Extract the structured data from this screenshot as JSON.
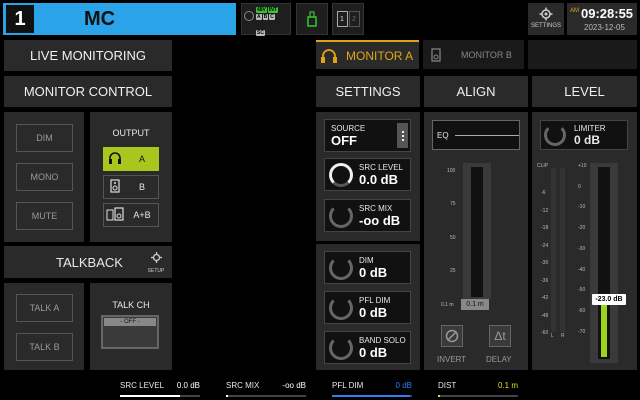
{
  "scene": {
    "number": "1",
    "name": "MC"
  },
  "io": {
    "upper_row": [
      "48V",
      "INT"
    ],
    "mid_row": [
      "A",
      "B",
      "C"
    ],
    "sc": "SC"
  },
  "settings_label": "SETTINGS",
  "clock": {
    "ampm": "AM",
    "time": "09:28:55",
    "date": "2023-12-05"
  },
  "left": {
    "live_monitoring": "LIVE MONITORING",
    "monitor_control": "MONITOR CONTROL",
    "dim": "DIM",
    "mono": "MONO",
    "mute": "MUTE",
    "output_title": "OUTPUT",
    "outputs": [
      {
        "label": "A",
        "icon": "headphones-icon",
        "selected": true
      },
      {
        "label": "B",
        "icon": "speaker-icon",
        "selected": false
      },
      {
        "label": "A+B",
        "icon": "speaker-pair-icon",
        "selected": false
      }
    ],
    "talkback": "TALKBACK",
    "talkback_setup": "SETUP",
    "talk_a": "TALK A",
    "talk_b": "TALK B",
    "talk_ch_title": "TALK CH",
    "talk_ch_value": "- OFF -"
  },
  "tabs": {
    "monitor_a": "MONITOR A",
    "monitor_b": "MONITOR B"
  },
  "settings": {
    "title": "SETTINGS",
    "source_label": "SOURCE",
    "source_value": "OFF",
    "src_level_label": "SRC LEVEL",
    "src_level_value": "0.0 dB",
    "src_mix_label": "SRC MIX",
    "src_mix_value": "-oo dB",
    "dim_label": "DIM",
    "dim_value": "0 dB",
    "pfl_dim_label": "PFL DIM",
    "pfl_dim_value": "0 dB",
    "band_solo_label": "BAND SOLO",
    "band_solo_value": "0 dB"
  },
  "align": {
    "title": "ALIGN",
    "eq_label": "EQ",
    "scale": [
      "100",
      "75",
      "50",
      "25"
    ],
    "min_label": "0.1 m",
    "value": "0.1 m",
    "invert": "INVERT",
    "delay": "DELAY"
  },
  "level": {
    "title": "LEVEL",
    "limiter_label": "LIMITER",
    "limiter_value": "0 dB",
    "clip": "CLIP",
    "meter_scale": [
      "-6",
      "-12",
      "-18",
      "-24",
      "-30",
      "-36",
      "-42",
      "-48",
      "-60"
    ],
    "fader_scale": [
      "+10",
      "0",
      "-10",
      "-20",
      "-30",
      "-40",
      "-50",
      "-60",
      "-70"
    ],
    "l": "L",
    "r": "R",
    "fader_value": "-23.0 dB",
    "fader_fraction": 0.28
  },
  "bottom": [
    {
      "label": "SRC LEVEL",
      "value": "0.0 dB",
      "color": "#ffffff",
      "fill": 0.75
    },
    {
      "label": "SRC MIX",
      "value": "-oo dB",
      "color": "#ffffff",
      "fill": 0.02
    },
    {
      "label": "PFL DIM",
      "value": "0 dB",
      "color": "#2e7ff0",
      "fill": 0.98
    },
    {
      "label": "DIST",
      "value": "0.1 m",
      "color": "#e0e020",
      "fill": 0.02
    }
  ],
  "colors": {
    "accent_blue": "#2aa3e8",
    "select_green": "#a7c61e",
    "tab_gold": "#e0a516",
    "meter_green": "#9bd41a"
  }
}
